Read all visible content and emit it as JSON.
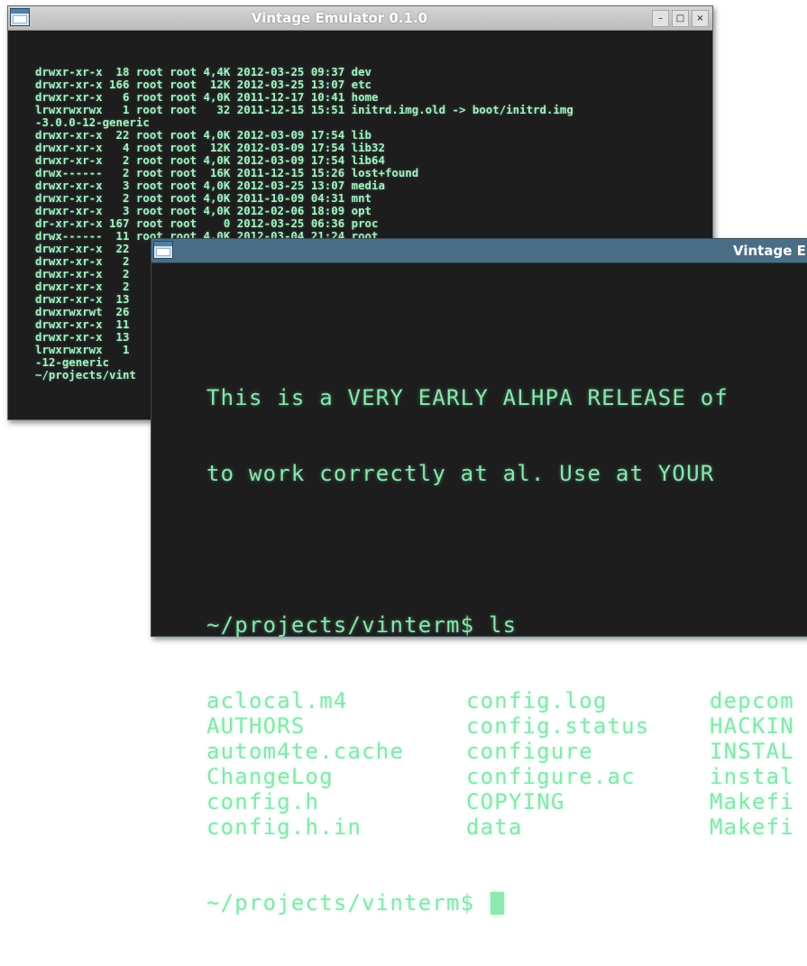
{
  "back_window": {
    "title": "Vintage Emulator 0.1.0",
    "buttons": {
      "minimize": "–",
      "maximize": "□",
      "close": "×"
    },
    "lines": [
      "drwxr-xr-x  18 root root 4,4K 2012-03-25 09:37 dev",
      "drwxr-xr-x 166 root root  12K 2012-03-25 13:07 etc",
      "drwxr-xr-x   6 root root 4,0K 2011-12-17 10:41 home",
      "lrwxrwxrwx   1 root root   32 2011-12-15 15:51 initrd.img.old -> boot/initrd.img",
      "-3.0.0-12-generic",
      "drwxr-xr-x  22 root root 4,0K 2012-03-09 17:54 lib",
      "drwxr-xr-x   4 root root  12K 2012-03-09 17:54 lib32",
      "drwxr-xr-x   2 root root 4,0K 2012-03-09 17:54 lib64",
      "drwx------   2 root root  16K 2011-12-15 15:26 lost+found",
      "drwxr-xr-x   3 root root 4,0K 2012-03-25 13:07 media",
      "drwxr-xr-x   2 root root 4,0K 2011-10-09 04:31 mnt",
      "drwxr-xr-x   3 root root 4,0K 2012-02-06 18:09 opt",
      "dr-xr-xr-x 167 root root    0 2012-03-25 06:36 proc",
      "drwx------  11 root root 4,0K 2012-03-04 21:24 root",
      "drwxr-xr-x  22",
      "drwxr-xr-x   2",
      "drwxr-xr-x   2",
      "drwxr-xr-x   2",
      "drwxr-xr-x  13",
      "drwxrwxrwt  26",
      "drwxr-xr-x  11",
      "drwxr-xr-x  13",
      "lrwxrwxrwx   1",
      "-12-generic",
      "~/projects/vint"
    ]
  },
  "front_window": {
    "title": "Vintage E",
    "banner": [
      "This is a VERY EARLY ALHPA RELEASE of",
      "to work correctly at al. Use at YOUR"
    ],
    "prompt": "~/projects/vinterm$ ls",
    "listing": [
      [
        "aclocal.m4",
        "config.log",
        "depcom"
      ],
      [
        "AUTHORS",
        "config.status",
        "HACKIN"
      ],
      [
        "autom4te.cache",
        "configure",
        "INSTAL"
      ],
      [
        "ChangeLog",
        "configure.ac",
        "instal"
      ],
      [
        "config.h",
        "COPYING",
        "Makefi"
      ],
      [
        "config.h.in",
        "data",
        "Makefi"
      ]
    ],
    "prompt_final": "~/projects/vinterm$ "
  }
}
